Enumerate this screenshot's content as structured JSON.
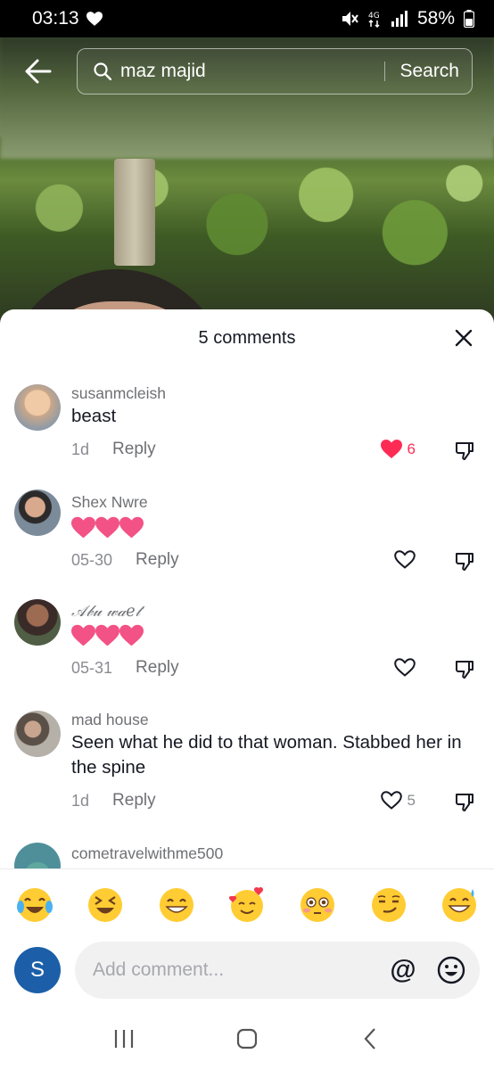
{
  "status_bar": {
    "time": "03:13",
    "battery": "58%",
    "network": "4G"
  },
  "search": {
    "query": "maz majid",
    "button_label": "Search"
  },
  "comments_sheet": {
    "title": "5 comments",
    "comments": [
      {
        "user": "susanmcleish",
        "text": "beast",
        "time": "1d",
        "reply_label": "Reply",
        "likes": "6",
        "liked": true
      },
      {
        "user": "Shex Nwre",
        "text": "",
        "time": "05-30",
        "reply_label": "Reply",
        "likes": "",
        "liked": false,
        "emoji_hearts": 3
      },
      {
        "user": "𝒜𝒷𝓊 𝓌𝒶𝑒𝓉",
        "text": "",
        "time": "05-31",
        "reply_label": "Reply",
        "likes": "",
        "liked": false,
        "emoji_hearts": 3
      },
      {
        "user": "mad house",
        "text": "Seen what he did to that woman. Stabbed her in the spine",
        "time": "1d",
        "reply_label": "Reply",
        "likes": "5",
        "liked": false
      },
      {
        "user": "cometravelwithme500"
      }
    ]
  },
  "quick_emojis": [
    "face-with-tears-of-joy",
    "grinning-squinting-face",
    "beaming-face",
    "smiling-face-with-hearts",
    "flushed-face",
    "smirking-face",
    "grinning-face-with-sweat"
  ],
  "composer": {
    "avatar_letter": "S",
    "placeholder": "Add comment...",
    "at_symbol": "@"
  },
  "colors": {
    "like_red": "#fe2c55",
    "avatar_blue": "#1c5fa8",
    "muted_text": "#8a8b91"
  }
}
